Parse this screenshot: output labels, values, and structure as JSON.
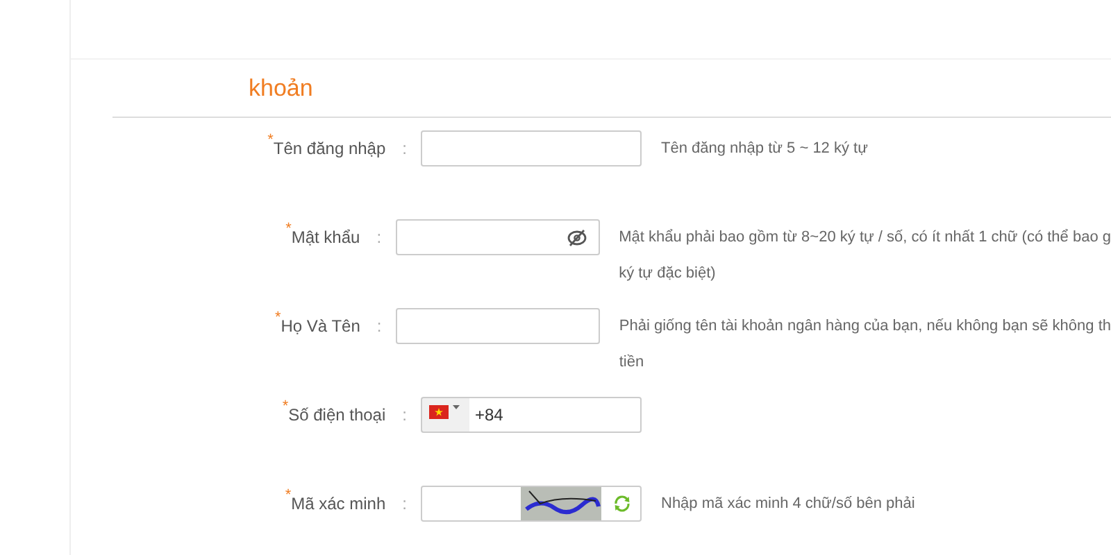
{
  "heading": "khoản",
  "fields": [
    {
      "kind": "text",
      "label": "Tên đăng nhập",
      "required_mark": "*",
      "colon": ":",
      "hint": [
        "Tên đăng nhập từ 5 ~ 12 ký tự"
      ]
    },
    {
      "kind": "password",
      "label": "Mật khẩu",
      "required_mark": "*",
      "colon": ":",
      "hint": [
        "Mật khẩu phải bao gồm từ 8~20 ký tự / số, có ít nhất 1 chữ (có thể bao g",
        "ký tự đặc biệt)"
      ]
    },
    {
      "kind": "text",
      "label": "Họ Và Tên",
      "required_mark": "*",
      "colon": ":",
      "hint": [
        "Phải giống tên tài khoản ngân hàng của bạn, nếu không bạn sẽ không th",
        "tiền"
      ]
    },
    {
      "kind": "phone",
      "label": "Số điện thoại",
      "required_mark": "*",
      "colon": ":",
      "value": "+84"
    },
    {
      "kind": "captcha",
      "label": "Mã xác minh",
      "required_mark": "*",
      "colon": ":",
      "hint": [
        "Nhập mã xác minh 4 chữ/số bên phải"
      ]
    }
  ]
}
